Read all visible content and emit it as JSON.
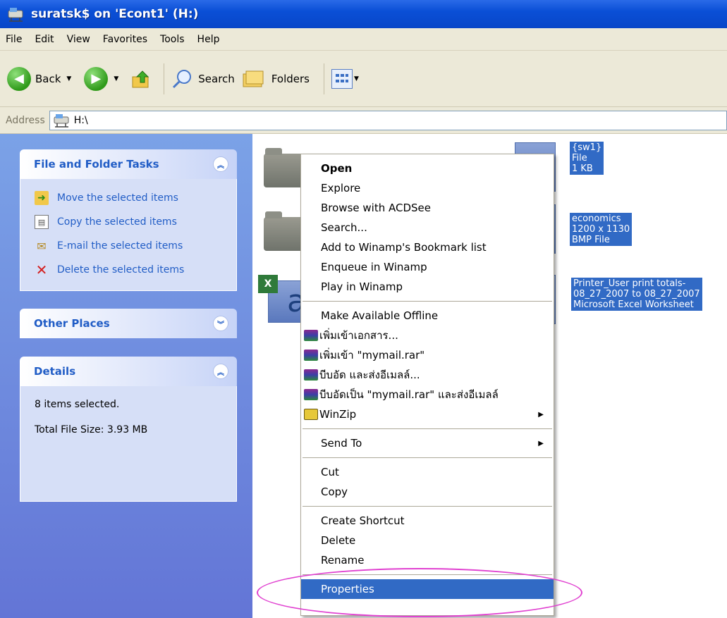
{
  "window": {
    "title": "suratsk$ on 'Econt1' (H:)"
  },
  "menubar": [
    "File",
    "Edit",
    "View",
    "Favorites",
    "Tools",
    "Help"
  ],
  "toolbar": {
    "back": "Back",
    "search": "Search",
    "folders": "Folders"
  },
  "address": {
    "label": "Address",
    "value": "H:\\"
  },
  "left": {
    "tasks_title": "File and Folder Tasks",
    "tasks": [
      "Move the selected items",
      "Copy the selected items",
      "E-mail the selected items",
      "Delete the selected items"
    ],
    "other_title": "Other Places",
    "details_title": "Details",
    "details_count": "8 items selected.",
    "details_size": "Total File Size: 3.93 MB"
  },
  "files": {
    "f1": [
      "{sw1}",
      "File",
      "1 KB"
    ],
    "f2": [
      "economics",
      "1200 x 1130",
      "BMP File"
    ],
    "f3": [
      "Printer_User print totals-",
      "08_27_2007 to 08_27_2007",
      "Microsoft Excel Worksheet"
    ]
  },
  "context_menu": {
    "open": "Open",
    "explore": "Explore",
    "acdsee": "Browse with ACDSee",
    "search": "Search...",
    "winamp_bookmark": "Add to Winamp's Bookmark list",
    "winamp_enqueue": "Enqueue in Winamp",
    "winamp_play": "Play in Winamp",
    "offline": "Make Available Offline",
    "rar1": "เพิ่มเข้าเอกสาร...",
    "rar2": "เพิ่มเข้า \"mymail.rar\"",
    "rar3": "บีบอัด และส่งอีเมลล์...",
    "rar4": "บีบอัดเป็น \"mymail.rar\" และส่งอีเมลล์",
    "winzip": "WinZip",
    "sendto": "Send To",
    "cut": "Cut",
    "copy": "Copy",
    "shortcut": "Create Shortcut",
    "delete": "Delete",
    "rename": "Rename",
    "properties": "Properties"
  },
  "colors": {
    "highlight": "#316ac5",
    "annotation": "#e040d0"
  }
}
